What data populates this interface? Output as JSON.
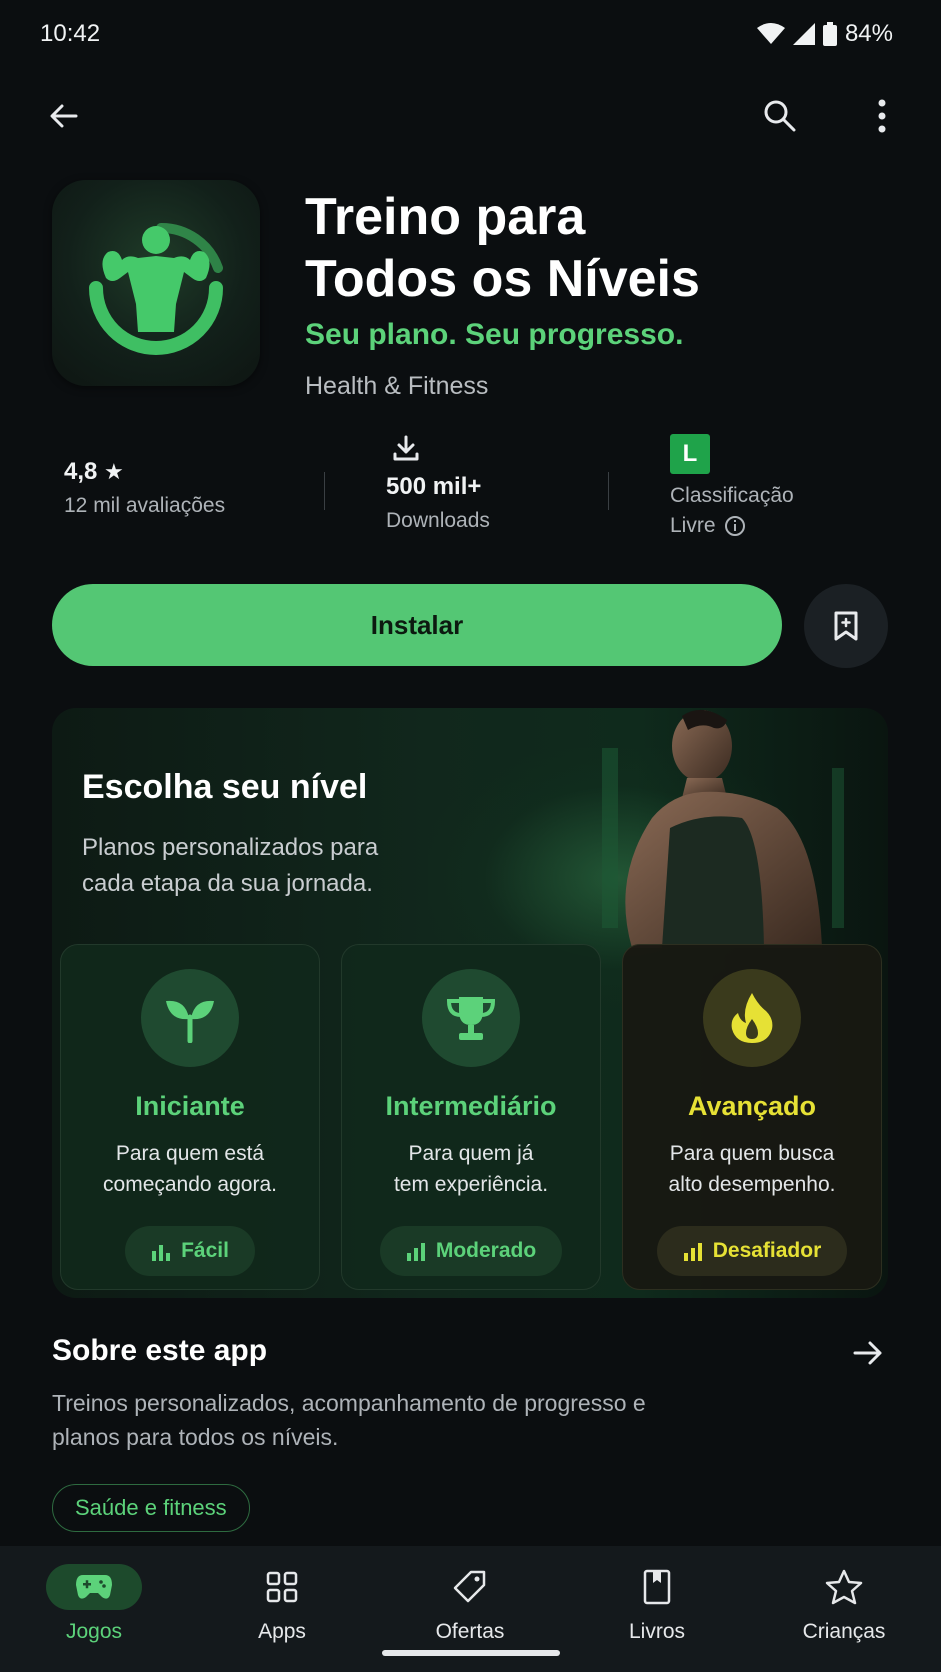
{
  "status_bar": {
    "time": "10:42",
    "battery": "84%"
  },
  "app": {
    "title_line1": "Treino para",
    "title_line2": "Todos os Níveis",
    "tagline": "Seu plano. Seu progresso.",
    "category": "Health & Fitness"
  },
  "stats": {
    "rating": "4,8",
    "rating_star": "★",
    "reviews": "12 mil avaliações",
    "downloads": "500 mil+",
    "downloads_label": "Downloads",
    "content_rating_badge": "L",
    "content_rating_line1": "Classificação",
    "content_rating_line2": "Livre"
  },
  "actions": {
    "install_label": "Instalar"
  },
  "promo": {
    "title": "Escolha seu nível",
    "subtitle": "Planos personalizados para cada etapa da sua jornada.",
    "levels": [
      {
        "name": "Iniciante",
        "desc_line1": "Para quem está",
        "desc_line2": "começando agora.",
        "difficulty": "Fácil",
        "icon": "sprout-icon",
        "color": "#5cd27a"
      },
      {
        "name": "Intermediário",
        "desc_line1": "Para quem já",
        "desc_line2": "tem experiência.",
        "difficulty": "Moderado",
        "icon": "trophy-icon",
        "color": "#5cd27a"
      },
      {
        "name": "Avançado",
        "desc_line1": "Para quem busca",
        "desc_line2": "alto desempenho.",
        "difficulty": "Desafiador",
        "icon": "flame-icon",
        "color": "#e6e135"
      }
    ]
  },
  "about": {
    "title": "Sobre este app",
    "description": "Treinos personalizados, acompanhamento de progresso e planos para todos os níveis.",
    "tag": "Saúde e fitness"
  },
  "bottom_nav": [
    {
      "label": "Jogos",
      "icon": "gamepad-icon",
      "active": true
    },
    {
      "label": "Apps",
      "icon": "apps-grid-icon",
      "active": false
    },
    {
      "label": "Ofertas",
      "icon": "tag-icon",
      "active": false
    },
    {
      "label": "Livros",
      "icon": "book-icon",
      "active": false
    },
    {
      "label": "Crianças",
      "icon": "star-icon",
      "active": false
    }
  ],
  "colors": {
    "accent": "#5cd27a",
    "install_button": "#54c774",
    "advanced": "#e6e135",
    "background": "#0b0e10"
  }
}
